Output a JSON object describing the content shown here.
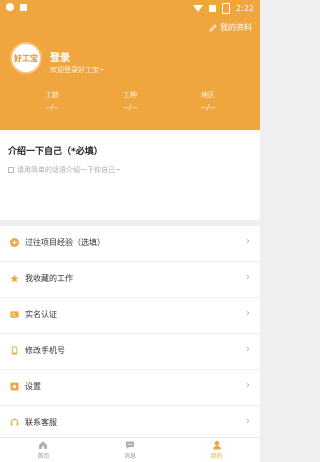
{
  "status_bar": {
    "time": "2:22"
  },
  "header": {
    "my_profile_label": "我的资料",
    "avatar_text": "好工宝",
    "login_label": "登录",
    "welcome_text": "欢迎登录好工宝~",
    "stats": [
      {
        "label": "工龄",
        "value": "--/--"
      },
      {
        "label": "工种",
        "value": "--/--"
      },
      {
        "label": "地区",
        "value": "--/--"
      }
    ]
  },
  "intro": {
    "title": "介绍一下自己（*必填）",
    "placeholder": "请用简单的话语介绍一下你自己~"
  },
  "menu": {
    "items": [
      {
        "label": "过往项目经验（选填）",
        "icon": "plus-circle-icon"
      },
      {
        "label": "我收藏的工作",
        "icon": "star-icon"
      },
      {
        "label": "实名认证",
        "icon": "id-card-icon"
      },
      {
        "label": "修改手机号",
        "icon": "phone-icon"
      },
      {
        "label": "设置",
        "icon": "settings-icon"
      },
      {
        "label": "联系客服",
        "icon": "headset-icon"
      }
    ]
  },
  "tabbar": {
    "tabs": [
      {
        "label": "首页",
        "icon": "home-icon"
      },
      {
        "label": "消息",
        "icon": "message-icon"
      },
      {
        "label": "我的",
        "icon": "profile-icon"
      }
    ]
  },
  "colors": {
    "accent": "#f0a63f",
    "background": "#efefef",
    "text": "#333333",
    "muted": "#aaaaaa"
  }
}
